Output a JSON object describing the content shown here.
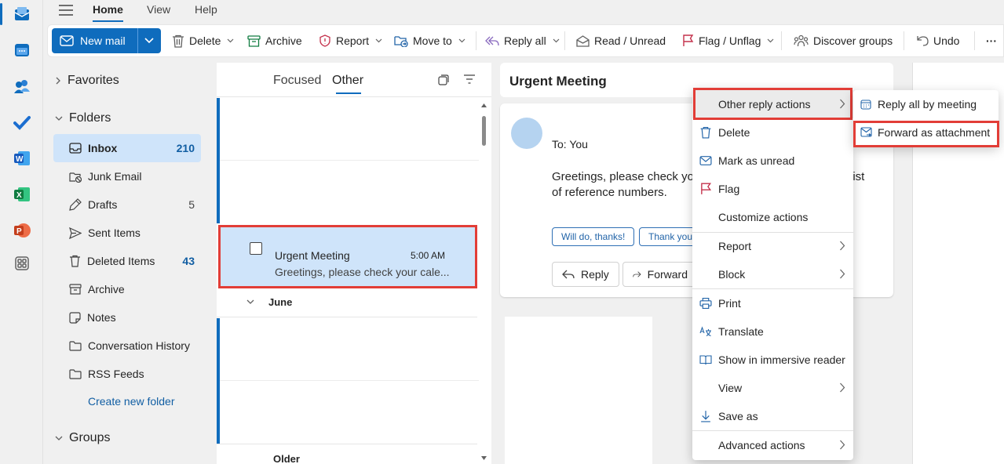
{
  "colors": {
    "accent": "#0f6cbd",
    "highlight": "#e23d37",
    "selected_bg": "#cfe4fa"
  },
  "menu": {
    "home": "Home",
    "view": "View",
    "help": "Help"
  },
  "ribbon": {
    "new_mail": "New mail",
    "delete": "Delete",
    "archive": "Archive",
    "report": "Report",
    "move_to": "Move to",
    "reply_all": "Reply all",
    "read_unread": "Read / Unread",
    "flag_unflag": "Flag / Unflag",
    "discover_groups": "Discover groups",
    "undo": "Undo",
    "more": "···"
  },
  "folders": {
    "favorites": "Favorites",
    "folders": "Folders",
    "groups": "Groups",
    "items": [
      {
        "label": "Inbox",
        "count": "210",
        "icon": "inbox-icon"
      },
      {
        "label": "Junk Email",
        "count": "",
        "icon": "junk-icon"
      },
      {
        "label": "Drafts",
        "count": "5",
        "icon": "drafts-icon"
      },
      {
        "label": "Sent Items",
        "count": "",
        "icon": "sent-icon"
      },
      {
        "label": "Deleted Items",
        "count": "43",
        "icon": "trash-icon"
      },
      {
        "label": "Archive",
        "count": "",
        "icon": "archive-icon"
      },
      {
        "label": "Notes",
        "count": "",
        "icon": "notes-icon"
      },
      {
        "label": "Conversation History",
        "count": "",
        "icon": "folder-icon"
      },
      {
        "label": "RSS Feeds",
        "count": "",
        "icon": "folder-icon"
      }
    ],
    "create_new": "Create new folder"
  },
  "list": {
    "tab_focused": "Focused",
    "tab_other": "Other",
    "selected_message": {
      "subject": "Urgent Meeting",
      "time": "5:00 AM",
      "preview": "Greetings, please check your cale..."
    },
    "group_june": "June",
    "group_older": "Older"
  },
  "reading": {
    "subject": "Urgent Meeting",
    "to_label": "To:",
    "to_value": "You",
    "body_line1a": "Greetings, please check yo",
    "body_line1b": "list",
    "body_line2": "of reference numbers.",
    "quick_reply_1": "Will do, thanks!",
    "quick_reply_2": "Thank you",
    "reply": "Reply",
    "forward": "Forward"
  },
  "context_menu": {
    "other_reply_actions": "Other reply actions",
    "delete": "Delete",
    "mark_unread": "Mark as unread",
    "flag": "Flag",
    "customize": "Customize actions",
    "report": "Report",
    "block": "Block",
    "print": "Print",
    "translate": "Translate",
    "immersive": "Show in immersive reader",
    "view": "View",
    "save_as": "Save as",
    "advanced": "Advanced actions"
  },
  "submenu": {
    "reply_all_meeting": "Reply all by meeting",
    "forward_attachment": "Forward as attachment"
  }
}
